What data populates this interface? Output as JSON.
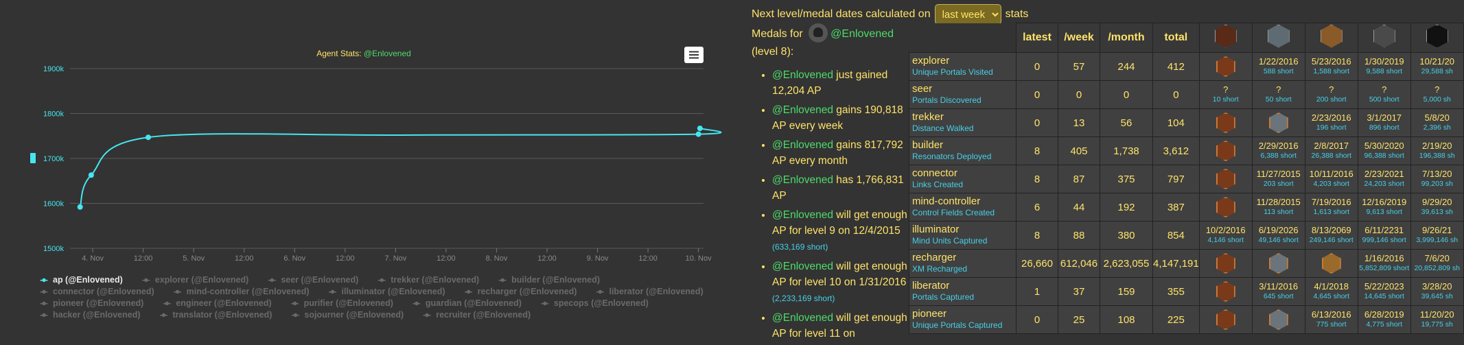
{
  "chart_data": {
    "type": "line",
    "title_prefix": "Agent Stats: ",
    "title_user": "@Enlovened",
    "x_ticks": [
      "4. Nov",
      "12:00",
      "5. Nov",
      "12:00",
      "6. Nov",
      "12:00",
      "7. Nov",
      "12:00",
      "8. Nov",
      "12:00",
      "9. Nov",
      "12:00",
      "10. Nov"
    ],
    "y_ticks": [
      "1500k",
      "1600k",
      "1700k",
      "1800k",
      "1900k"
    ],
    "ylim": [
      1500,
      1900
    ],
    "xlim": [
      -0.45,
      12.1
    ],
    "grid": true,
    "series": [
      {
        "name": "ap (@Enlovened)",
        "color": "#46e6f0",
        "points": [
          [
            -0.25,
            1592
          ],
          [
            -0.03,
            1663
          ],
          [
            1.1,
            1747
          ],
          [
            6.1,
            1752
          ],
          [
            12.0,
            1754
          ],
          [
            12.03,
            1767
          ]
        ],
        "markers": [
          [
            -0.25,
            1592
          ],
          [
            -0.03,
            1663
          ],
          [
            1.1,
            1747
          ],
          [
            12.0,
            1754
          ],
          [
            12.03,
            1767
          ]
        ]
      }
    ],
    "legend": [
      {
        "label": "ap (@Enlovened)",
        "active": true
      },
      {
        "label": "explorer (@Enlovened)",
        "active": false
      },
      {
        "label": "seer (@Enlovened)",
        "active": false
      },
      {
        "label": "trekker (@Enlovened)",
        "active": false
      },
      {
        "label": "builder (@Enlovened)",
        "active": false
      },
      {
        "label": "connector (@Enlovened)",
        "active": false
      },
      {
        "label": "mind-controller (@Enlovened)",
        "active": false
      },
      {
        "label": "illuminator (@Enlovened)",
        "active": false
      },
      {
        "label": "recharger (@Enlovened)",
        "active": false
      },
      {
        "label": "liberator (@Enlovened)",
        "active": false
      },
      {
        "label": "pioneer (@Enlovened)",
        "active": false
      },
      {
        "label": "engineer (@Enlovened)",
        "active": false
      },
      {
        "label": "purifier (@Enlovened)",
        "active": false
      },
      {
        "label": "guardian (@Enlovened)",
        "active": false
      },
      {
        "label": "specops (@Enlovened)",
        "active": false
      },
      {
        "label": "hacker (@Enlovened)",
        "active": false
      },
      {
        "label": "translator (@Enlovened)",
        "active": false
      },
      {
        "label": "sojourner (@Enlovened)",
        "active": false
      },
      {
        "label": "recruiter (@Enlovened)",
        "active": false
      }
    ]
  },
  "header": {
    "prefix": "Next level/medal dates calculated on",
    "selected_period": "last week",
    "suffix": "stats"
  },
  "medals_for": {
    "label": "Medals for",
    "user": "@Enlovened",
    "level": "(level 8):"
  },
  "stats_list": [
    {
      "user": "@Enlovened",
      "text": " just gained 12,204 AP",
      "note": ""
    },
    {
      "user": "@Enlovened",
      "text": " gains 190,818 AP every week",
      "note": ""
    },
    {
      "user": "@Enlovened",
      "text": " gains 817,792 AP every month",
      "note": ""
    },
    {
      "user": "@Enlovened",
      "text": " has 1,766,831 AP",
      "note": ""
    },
    {
      "user": "@Enlovened",
      "text": " will get enough AP for level 9 on 12/4/2015 ",
      "note": "(633,169 short)"
    },
    {
      "user": "@Enlovened",
      "text": " will get enough AP for level 10 on 1/31/2016 ",
      "note": "(2,233,169 short)"
    },
    {
      "user": "@Enlovened",
      "text": " will get enough AP for level 11 on",
      "note": ""
    }
  ],
  "table": {
    "headers": [
      "latest",
      "/week",
      "/month",
      "total"
    ],
    "medal_colors": [
      "#5a2a18",
      "#5f6b72",
      "#8a5a28",
      "#4a4a4a",
      "#111111"
    ],
    "rows": [
      {
        "name": "explorer",
        "sub": "Unique Portals Visited",
        "latest": "0",
        "week": "57",
        "month": "244",
        "total": "412",
        "badges": [
          {
            "icon": "explorer-bronze-icon",
            "color": "#7a3a1a"
          },
          {
            "date": "1/22/2016",
            "short": "588 short"
          },
          {
            "date": "5/23/2016",
            "short": "1,588 short"
          },
          {
            "date": "1/30/2019",
            "short": "9,588 short"
          },
          {
            "date": "10/21/20",
            "short": "29,588 sh"
          }
        ]
      },
      {
        "name": "seer",
        "sub": "Portals Discovered",
        "latest": "0",
        "week": "0",
        "month": "0",
        "total": "0",
        "badges": [
          {
            "date": "?",
            "short": "10 short"
          },
          {
            "date": "?",
            "short": "50 short"
          },
          {
            "date": "?",
            "short": "200 short"
          },
          {
            "date": "?",
            "short": "500 short"
          },
          {
            "date": "?",
            "short": "5,000 sh"
          }
        ]
      },
      {
        "name": "trekker",
        "sub": "Distance Walked",
        "latest": "0",
        "week": "13",
        "month": "56",
        "total": "104",
        "badges": [
          {
            "icon": "trekker-bronze-icon",
            "color": "#7a3a1a"
          },
          {
            "icon": "trekker-silver-icon",
            "color": "#6a747a"
          },
          {
            "date": "2/23/2016",
            "short": "196 short"
          },
          {
            "date": "3/1/2017",
            "short": "896 short"
          },
          {
            "date": "5/8/20",
            "short": "2,396 sh"
          }
        ]
      },
      {
        "name": "builder",
        "sub": "Resonators Deployed",
        "latest": "8",
        "week": "405",
        "month": "1,738",
        "total": "3,612",
        "badges": [
          {
            "icon": "builder-bronze-icon",
            "color": "#7a3a1a"
          },
          {
            "date": "2/29/2016",
            "short": "6,388 short"
          },
          {
            "date": "2/8/2017",
            "short": "26,388 short"
          },
          {
            "date": "5/30/2020",
            "short": "96,388 short"
          },
          {
            "date": "2/19/20",
            "short": "196,388 sh"
          }
        ]
      },
      {
        "name": "connector",
        "sub": "Links Created",
        "latest": "8",
        "week": "87",
        "month": "375",
        "total": "797",
        "badges": [
          {
            "icon": "connector-bronze-icon",
            "color": "#7a3a1a"
          },
          {
            "date": "11/27/2015",
            "short": "203 short"
          },
          {
            "date": "10/11/2016",
            "short": "4,203 short"
          },
          {
            "date": "2/23/2021",
            "short": "24,203 short"
          },
          {
            "date": "7/13/20",
            "short": "99,203 sh"
          }
        ]
      },
      {
        "name": "mind-controller",
        "sub": "Control Fields Created",
        "latest": "6",
        "week": "44",
        "month": "192",
        "total": "387",
        "badges": [
          {
            "icon": "mind-controller-bronze-icon",
            "color": "#7a3a1a"
          },
          {
            "date": "11/28/2015",
            "short": "113 short"
          },
          {
            "date": "7/19/2016",
            "short": "1,613 short"
          },
          {
            "date": "12/16/2019",
            "short": "9,613 short"
          },
          {
            "date": "9/29/20",
            "short": "39,613 sh"
          }
        ]
      },
      {
        "name": "illuminator",
        "sub": "Mind Units Captured",
        "latest": "8",
        "week": "88",
        "month": "380",
        "total": "854",
        "badges": [
          {
            "date": "10/2/2016",
            "short": "4,146 short"
          },
          {
            "date": "6/19/2026",
            "short": "49,146 short"
          },
          {
            "date": "8/13/2069",
            "short": "249,146 short"
          },
          {
            "date": "6/11/2231",
            "short": "999,146 short"
          },
          {
            "date": "9/26/21",
            "short": "3,999,146 sh"
          }
        ]
      },
      {
        "name": "recharger",
        "sub": "XM Recharged",
        "latest": "26,660",
        "week": "612,046",
        "month": "2,623,055",
        "total": "4,147,191",
        "badges": [
          {
            "icon": "recharger-bronze-icon",
            "color": "#7a3a1a"
          },
          {
            "icon": "recharger-silver-icon",
            "color": "#6a747a"
          },
          {
            "icon": "recharger-gold-icon",
            "color": "#9a6a2a"
          },
          {
            "date": "1/16/2016",
            "short": "5,852,809 short"
          },
          {
            "date": "7/6/20",
            "short": "20,852,809 sh"
          }
        ]
      },
      {
        "name": "liberator",
        "sub": "Portals Captured",
        "latest": "1",
        "week": "37",
        "month": "159",
        "total": "355",
        "badges": [
          {
            "icon": "liberator-bronze-icon",
            "color": "#7a3a1a"
          },
          {
            "date": "3/11/2016",
            "short": "645 short"
          },
          {
            "date": "4/1/2018",
            "short": "4,645 short"
          },
          {
            "date": "5/22/2023",
            "short": "14,645 short"
          },
          {
            "date": "3/28/20",
            "short": "39,645 sh"
          }
        ]
      },
      {
        "name": "pioneer",
        "sub": "Unique Portals Captured",
        "latest": "0",
        "week": "25",
        "month": "108",
        "total": "225",
        "badges": [
          {
            "icon": "pioneer-bronze-icon",
            "color": "#7a3a1a"
          },
          {
            "icon": "pioneer-silver-icon",
            "color": "#6a747a"
          },
          {
            "date": "6/13/2016",
            "short": "775 short"
          },
          {
            "date": "6/28/2019",
            "short": "4,775 short"
          },
          {
            "date": "11/20/20",
            "short": "19,775 sh"
          }
        ]
      }
    ]
  }
}
